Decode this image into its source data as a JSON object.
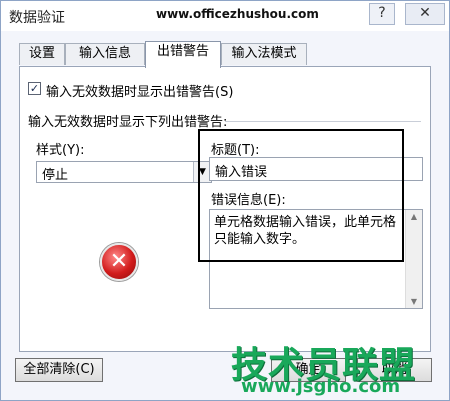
{
  "window": {
    "title": "数据验证",
    "watermark_url": "www.officezhushou.com",
    "help_label": "?",
    "close_label": "✕"
  },
  "tabs": [
    {
      "label": "设置"
    },
    {
      "label": "输入信息"
    },
    {
      "label": "出错警告",
      "active": true
    },
    {
      "label": "输入法模式"
    }
  ],
  "panel": {
    "show_error_checkbox": {
      "label": "输入无效数据时显示出错警告(S)",
      "checked": true,
      "mark": "✓"
    },
    "group_label": "输入无效数据时显示下列出错警告:",
    "style": {
      "label": "样式(Y):",
      "value": "停止"
    },
    "error_title": {
      "label": "标题(T):",
      "value": "输入错误"
    },
    "error_message": {
      "label": "错误信息(E):",
      "value": "单元格数据输入错误，此单元格只能输入数字。"
    },
    "error_icon_glyph": "✕"
  },
  "footer": {
    "clear_all": "全部清除(C)",
    "ok": "确定",
    "cancel": "取消"
  },
  "overlay_watermark": {
    "brand": "技术员联盟",
    "url": "www.jsgho.com"
  }
}
